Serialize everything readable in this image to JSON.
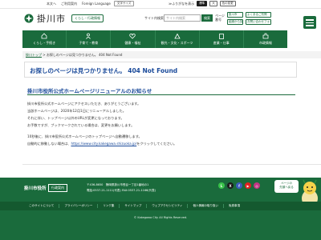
{
  "utility": {
    "items": [
      "本文へ",
      "ご利用案内",
      "Foreign Language"
    ],
    "select_label": "文字サイズ",
    "right_label": "≫ふりがなを表示",
    "pills": [
      "標準",
      "大",
      "色の変更"
    ]
  },
  "header": {
    "site_name": "掛川市",
    "life_info": "くらし・行政情報",
    "search_label": "サイト内検索",
    "search_placeholder": "サイト内検索",
    "search_button": "検索",
    "page_id_label": "ページ\n番号",
    "links": [
      "掛川市",
      "よくあるご質問",
      "組織から探す",
      "お問い合わせフォーム"
    ]
  },
  "nav": {
    "items": [
      {
        "label": "くらし・手続き",
        "icon": "home-icon"
      },
      {
        "label": "子育て・教育",
        "icon": "child-icon"
      },
      {
        "label": "健康・福祉",
        "icon": "heart-icon"
      },
      {
        "label": "観光・文化・スポーツ",
        "icon": "tourism-icon"
      },
      {
        "label": "産業・仕事",
        "icon": "building-icon"
      },
      {
        "label": "市政情報",
        "icon": "city-icon"
      }
    ]
  },
  "breadcrumb": {
    "home": "掛川トップ",
    "sep": ">",
    "current": "お探しのページは見つかりません。 404 Not Found"
  },
  "main": {
    "title": "お探しのページは見つかりません。 404 Not Found",
    "subtitle": "掛川市役所公式ホームページリニューアルのお知らせ",
    "paragraphs": [
      "掛川市役所公式ホームページにアクセスいただき、ありがとうございます。",
      "当該ホームページは、2020年12月1日にリニューアルしました。",
      "それに伴い、トップページ以外のURLが変更になっております。",
      "お手数ですが、ブックマークされている場合は、変更をお願いします。"
    ],
    "redirect_line": "10秒後に、掛川市役所公式ホームページのトップページへ自動遷移します。",
    "redirect_prefix": "自動的に移動しない場合は、",
    "redirect_link": "https://www.city.kakegawa.shizuoka.jp/",
    "redirect_suffix": "をクリックしてください。"
  },
  "footer": {
    "name": "掛川市役所",
    "corp_button": "行政案内",
    "address_lines": [
      "〒436-8650　静岡県掛川市長谷一丁目1番地の1",
      "電話:0537-21-1111(代表) FAX:0537-21-1166(代表)"
    ],
    "socials": [
      {
        "name": "LINE",
        "icon": "line-icon",
        "color": "#3ac34b"
      },
      {
        "name": "X",
        "icon": "x-icon",
        "color": "#1a1a1a"
      },
      {
        "name": "Facebook",
        "icon": "facebook-icon",
        "color": "#3b5bbd"
      },
      {
        "name": "YouTube",
        "icon": "youtube-icon",
        "color": "#e02020"
      },
      {
        "name": "Instagram",
        "icon": "instagram-icon",
        "color": "#c13584"
      }
    ],
    "pagetop": "ページの\n先頭へ戻る",
    "links": [
      "このサイトについて",
      "プライバシーポリシー",
      "リンク集",
      "サイトマップ",
      "ウェブアクセシビリティ",
      "個人情報の取り扱い",
      "免責事項"
    ],
    "copyright": "© Kakegawa City All Rights Reserved."
  },
  "colors": {
    "brand_green": "#1a6b3c",
    "title_blue": "#1a4a9a"
  }
}
